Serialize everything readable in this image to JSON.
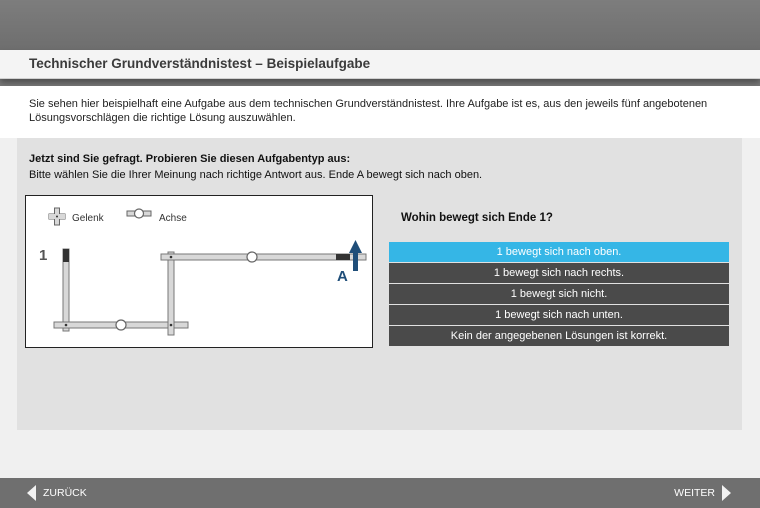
{
  "header": {
    "title": "Technischer Grundverständnistest – Beispielaufgabe"
  },
  "intro": {
    "text": "Sie sehen hier beispielhaft eine Aufgabe aus dem technischen Grundverständnistest. Ihre Aufgabe ist es, aus den jeweils fünf angebotenen Lösungsvorschlägen die richtige Lösung auszuwählen."
  },
  "task": {
    "heading": "Jetzt sind Sie gefragt. Probieren Sie diesen Aufgabentyp aus:",
    "instruction": "Bitte wählen Sie die Ihrer Meinung nach richtige Antwort aus. Ende A bewegt sich nach oben."
  },
  "diagram": {
    "legend_joint": "Gelenk",
    "legend_axis": "Achse",
    "label_end1": "1",
    "label_endA": "A",
    "arrow_icon": "arrow-up-icon",
    "accent_color": "#1f4e79"
  },
  "question": {
    "text": "Wohin bewegt sich Ende 1?"
  },
  "answers": [
    {
      "label": "1 bewegt sich nach oben.",
      "selected": true
    },
    {
      "label": "1 bewegt sich nach rechts.",
      "selected": false
    },
    {
      "label": "1 bewegt sich nicht.",
      "selected": false
    },
    {
      "label": "1 bewegt sich nach unten.",
      "selected": false
    },
    {
      "label": "Kein der angegebenen Lösungen ist korrekt.",
      "selected": false
    }
  ],
  "nav": {
    "back_label": "ZURÜCK",
    "next_label": "WEITER"
  },
  "colors": {
    "selected": "#35b6e6",
    "answer_bg": "#4a4a4a"
  }
}
